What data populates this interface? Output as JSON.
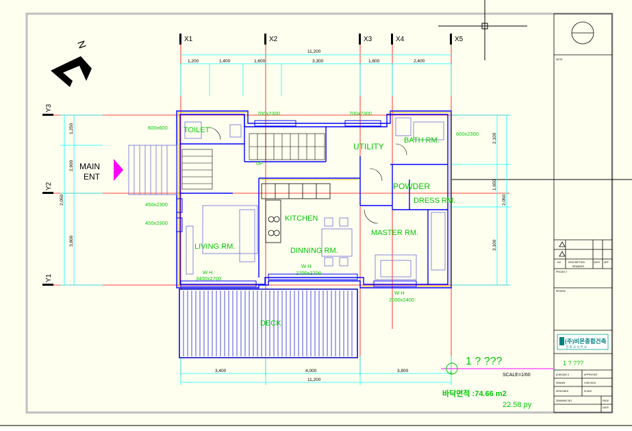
{
  "colors": {
    "paper": "#FFFFF0",
    "frame": "#BFBFBF",
    "grid": "#FF0000",
    "dim": "#00FFFF",
    "wall": "#0000FF",
    "label": "#00C800",
    "deck": "#0000C0",
    "furniture": "#6A6AD8",
    "text": "#000000"
  },
  "grid_labels": {
    "x": [
      "X1",
      "X2",
      "X3",
      "X4",
      "X5"
    ],
    "y": [
      "Y3",
      "Y2",
      "Y1"
    ]
  },
  "dimensions": {
    "top_total": "11,200",
    "top_segments": [
      "1,200",
      "1,400",
      "1,600",
      "3,300",
      "1,600",
      "2,400"
    ],
    "bottom_segments": [
      "3,400",
      "4,000",
      "3,800"
    ],
    "bottom_total": "11,200",
    "left_segments": [
      "1,250",
      "2,900",
      "3,800"
    ],
    "left_sub": "2,050",
    "right_segments": [
      "2,100",
      "1,650",
      "3,100"
    ],
    "right_sub": "2,050"
  },
  "north_label": "N",
  "entrance": {
    "line1": "MAIN",
    "line2": "ENT"
  },
  "rooms": {
    "toilet": "TOILET",
    "utility": "UTILITY",
    "bath": "BATH RM.",
    "powder": "POWDER",
    "dress": "DRESS RM.",
    "kitchen": "KITCHEN",
    "living": "LIVING RM.",
    "dining": "DINNING RM.",
    "master": "MASTER RM.",
    "deck": "DECK",
    "up": "UP"
  },
  "openings": {
    "toilet_win": "600x600",
    "top_a": "700x2300",
    "top_b": "700x2300",
    "bath_win": "600x2300",
    "left_a": "450x2300",
    "left_b": "450x2300",
    "living_wh": "W      H",
    "living_win": "3400x2700",
    "dining_wh": "W      H",
    "dining_win": "2700x2700",
    "master_wh": "W      H",
    "master_win": "2000x2400"
  },
  "title_info": {
    "plan_title": "1 ? ???",
    "scale": "SCALE=1/60",
    "area_label": "바닥면적 :74.66 m2",
    "area_py": "22.58 py",
    "marker": "A",
    "firm": "(주)비몬종합건축",
    "firm_sub": "건 축 사 사 무 소",
    "block_title": "1 ? ???",
    "notes": "NOTE",
    "rev_desc": "DESCRIPTION",
    "rev_no": "NO",
    "rev_date": "DATE",
    "rev_appr": "APP",
    "rev_remark": "REMARKS",
    "dwg_no": "DRAWING NO.",
    "tiny_1": "(DWG)NO.3",
    "tiny_2": "APPROVED",
    "tiny_3": "DRAWN",
    "tiny_4": "CHECKED",
    "tiny_5": "DESIGNED",
    "tiny_6": "SCALE",
    "tiny_7": "DATE",
    "tiny_8": "PROJECT",
    "tiny_9": "REVIEW",
    "tiny_10": "PAGE"
  }
}
